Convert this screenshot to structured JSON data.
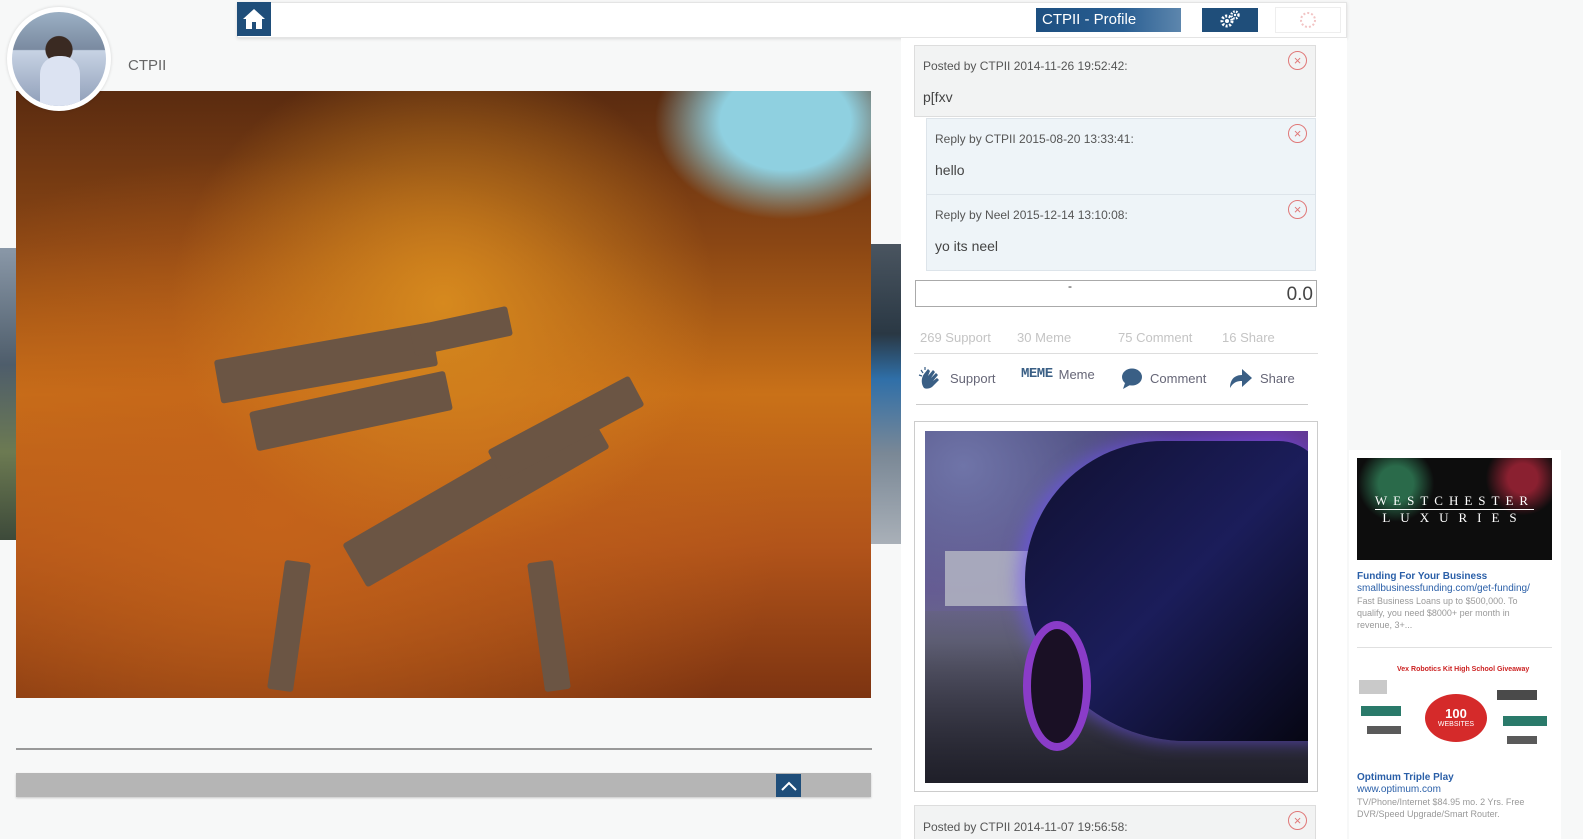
{
  "topbar": {
    "profile_label": "CTPII - Profile",
    "icons": {
      "home": "home-icon",
      "settings": "gear-icon",
      "loader": "spinner-icon"
    }
  },
  "profile": {
    "username": "CTPII"
  },
  "comments": [
    {
      "meta": "Posted by CTPII 2014-11-26 19:52:42:",
      "text": "p[fxv"
    },
    {
      "meta": "Reply by CTPII 2015-08-20 13:33:41:",
      "text": "hello"
    },
    {
      "meta": "Reply by Neel 2015-12-14 13:10:08:",
      "text": "yo its neel"
    }
  ],
  "rating": {
    "dash": "-",
    "value": "0.0"
  },
  "stats": {
    "support": "269 Support",
    "meme": "30 Meme",
    "comment": "75 Comment",
    "share": "16 Share"
  },
  "actions": {
    "support": "Support",
    "meme_icon": "MEME",
    "meme": "Meme",
    "comment": "Comment",
    "share": "Share"
  },
  "next_post": {
    "meta": "Posted by CTPII 2014-11-07 19:56:58:"
  },
  "ads": [
    {
      "logo_line1": "WESTCHESTER",
      "logo_line2": "LUXURIES",
      "title": "Funding For Your Business",
      "url": "smallbusinessfunding.com/get-funding/",
      "desc": "Fast Business Loans up to $500,000. To qualify, you need $8000+ per month in revenue, 3+..."
    },
    {
      "img_heading": "Vex Robotics Kit High School Giveaway",
      "badge_number": "100",
      "badge_text": "WEBSITES",
      "title": "Optimum Triple Play",
      "url": "www.optimum.com",
      "desc": "TV/Phone/Internet $84.95 mo. 2 Yrs. Free DVR/Speed Upgrade/Smart Router."
    }
  ],
  "colors": {
    "brand_blue": "#1f4e7a",
    "delete_red": "#e07878",
    "link_blue": "#2a5fa8"
  }
}
